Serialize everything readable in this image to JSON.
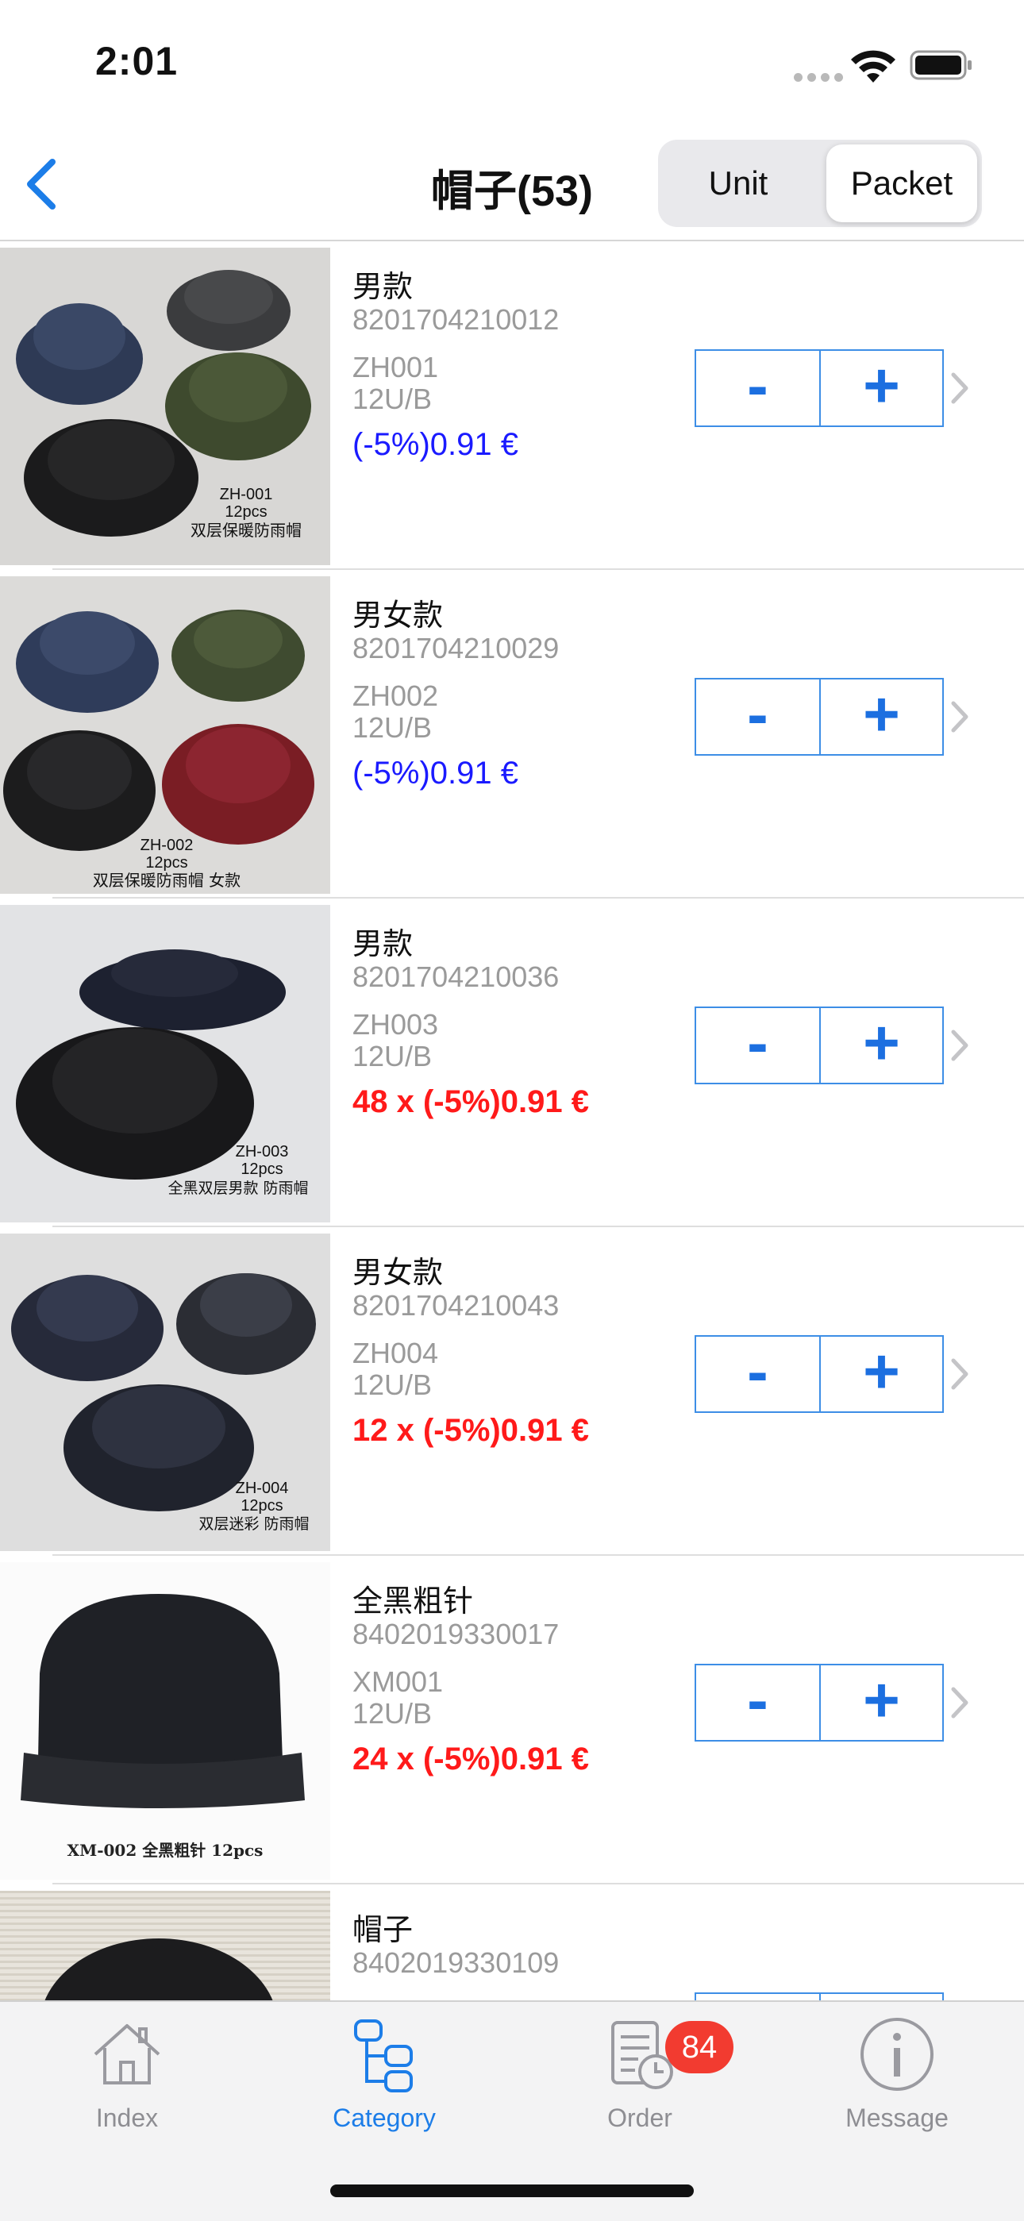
{
  "status_bar": {
    "time": "2:01"
  },
  "nav": {
    "title": "帽子(53)",
    "segments": {
      "unit": "Unit",
      "packet": "Packet",
      "selected": "Packet"
    }
  },
  "products": [
    {
      "name": "男款",
      "barcode": "8201704210012",
      "code": "ZH001",
      "pack": "12U/B",
      "price": "(-5%)0.91 €",
      "price_style": "blue",
      "image_caption": [
        "ZH-001",
        "12pcs",
        "双层保暖防雨帽"
      ]
    },
    {
      "name": "男女款",
      "barcode": "8201704210029",
      "code": "ZH002",
      "pack": "12U/B",
      "price": "(-5%)0.91 €",
      "price_style": "blue",
      "image_caption": [
        "ZH-002",
        "12pcs",
        "双层保暖防雨帽 女款"
      ]
    },
    {
      "name": "男款",
      "barcode": "8201704210036",
      "code": "ZH003",
      "pack": "12U/B",
      "price": "48 x (-5%)0.91 €",
      "price_style": "red",
      "image_caption": [
        "ZH-003",
        "12pcs",
        "全黑双层男款 防雨帽"
      ]
    },
    {
      "name": "男女款",
      "barcode": "8201704210043",
      "code": "ZH004",
      "pack": "12U/B",
      "price": "12 x (-5%)0.91 €",
      "price_style": "red",
      "image_caption": [
        "ZH-004",
        "12pcs",
        "双层迷彩 防雨帽"
      ]
    },
    {
      "name": "全黑粗针",
      "barcode": "8402019330017",
      "code": "XM001",
      "pack": "12U/B",
      "price": "24 x (-5%)0.91 €",
      "price_style": "red",
      "image_caption": [
        "XM-002 全黑粗针 12pcs"
      ]
    },
    {
      "name": "帽子",
      "barcode": "8402019330109",
      "code": "",
      "pack": "",
      "price": "",
      "price_style": "red",
      "image_caption": []
    }
  ],
  "stepper": {
    "minus": "-",
    "plus": "+"
  },
  "tabbar": {
    "items": [
      {
        "label": "Index",
        "icon": "home-icon"
      },
      {
        "label": "Category",
        "icon": "category-tree-icon",
        "active": true
      },
      {
        "label": "Order",
        "icon": "order-list-clock-icon",
        "badge": "84"
      },
      {
        "label": "Message",
        "icon": "info-circle-icon"
      }
    ]
  },
  "colors": {
    "accent": "#1c7de8",
    "price_blue": "#1a1aff",
    "price_red": "#ff1a1a",
    "badge": "#f23b30"
  }
}
